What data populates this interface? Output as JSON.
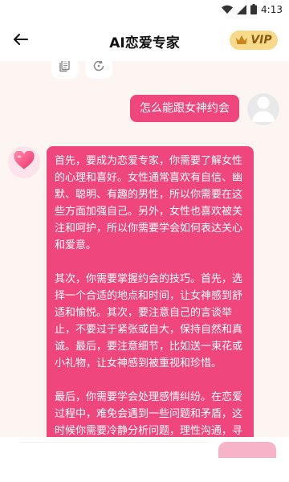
{
  "status_bar": {
    "time": "4:13"
  },
  "header": {
    "title": "AI恋爱专家",
    "vip_label": "VIP"
  },
  "chat": {
    "user_message": "怎么能跟女神约会",
    "bot_paragraphs": [
      "首先，要成为恋爱专家，你需要了解女性的心理和喜好。女性通常喜欢有自信、幽默、聪明、有趣的男性，所以你需要在这些方面加强自己。另外，女性也喜欢被关注和呵护，所以你需要学会如何表达关心和爱意。",
      "其次，你需要掌握约会的技巧。首先，选择一个合适的地点和时间，让女神感到舒适和愉悦。其次，要注意自己的言谈举止，不要过于紧张或自大，保持自然和真诚。最后，要注意细节，比如送一束花或小礼物，让女神感到被重视和珍惜。",
      "最后，你需要学会处理感情纠纷。在恋爱过程中，难免会遇到一些问题和矛盾，这时候你需要冷静分析问题，理性沟通，寻找解决问题的"
    ]
  },
  "colors": {
    "accent": "#f0467e",
    "background": "#fdf5f1",
    "vip_gold": "#f6d98a"
  }
}
